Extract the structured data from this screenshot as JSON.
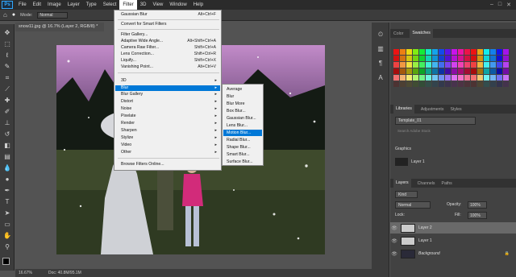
{
  "menubar": {
    "logo": "Ps",
    "items": [
      "File",
      "Edit",
      "Image",
      "Layer",
      "Type",
      "Select",
      "Filter",
      "3D",
      "View",
      "Window",
      "Help"
    ],
    "active": "Filter",
    "win_controls": [
      "–",
      "□",
      "✕"
    ]
  },
  "options": {
    "mode_label": "Mode:",
    "mode_value": "Normal",
    "opacity_label": "Opacity:",
    "opacity_value": "100%"
  },
  "document": {
    "tab": "snow11.jpg @ 16.7% (Layer 2, RGB/8) *",
    "zoom": "16.67%",
    "doc_size": "Doc: 40.8M/95.1M"
  },
  "filter_menu": {
    "items": [
      {
        "label": "Gaussian Blur",
        "shortcut": "Alt+Ctrl+F"
      },
      {
        "label": "Convert for Smart Filters",
        "shortcut": ""
      },
      {
        "label": "Filter Gallery...",
        "shortcut": ""
      },
      {
        "label": "Adaptive Wide Angle...",
        "shortcut": "Alt+Shift+Ctrl+A"
      },
      {
        "label": "Camera Raw Filter...",
        "shortcut": "Shift+Ctrl+A"
      },
      {
        "label": "Lens Correction...",
        "shortcut": "Shift+Ctrl+R"
      },
      {
        "label": "Liquify...",
        "shortcut": "Shift+Ctrl+X"
      },
      {
        "label": "Vanishing Point...",
        "shortcut": "Alt+Ctrl+V"
      },
      {
        "label": "3D",
        "shortcut": ""
      },
      {
        "label": "Blur",
        "shortcut": ""
      },
      {
        "label": "Blur Gallery",
        "shortcut": ""
      },
      {
        "label": "Distort",
        "shortcut": ""
      },
      {
        "label": "Noise",
        "shortcut": ""
      },
      {
        "label": "Pixelate",
        "shortcut": ""
      },
      {
        "label": "Render",
        "shortcut": ""
      },
      {
        "label": "Sharpen",
        "shortcut": ""
      },
      {
        "label": "Stylize",
        "shortcut": ""
      },
      {
        "label": "Video",
        "shortcut": ""
      },
      {
        "label": "Other",
        "shortcut": ""
      },
      {
        "label": "Browse Filters Online...",
        "shortcut": ""
      }
    ]
  },
  "blur_submenu": {
    "items": [
      "Average",
      "Blur",
      "Blur More",
      "Box Blur...",
      "Gaussian Blur...",
      "Lens Blur...",
      "Motion Blur...",
      "Radial Blur...",
      "Shape Blur...",
      "Smart Blur...",
      "Surface Blur..."
    ],
    "highlighted": "Motion Blur..."
  },
  "panels": {
    "color_tabs": [
      "Color",
      "Swatches"
    ],
    "library_tabs": [
      "Libraries",
      "Adjustments",
      "Styles"
    ],
    "library_name": "Template_01",
    "library_search": "Search Adobe Stock",
    "graphics_label": "Graphics",
    "graphics_item": "Layer 1",
    "layer_tabs": [
      "Layers",
      "Channels",
      "Paths"
    ],
    "kind_filter": "Kind",
    "blend_mode": "Normal",
    "opacity_label": "Opacity:",
    "opacity_value": "100%",
    "lock_label": "Lock:",
    "fill_label": "Fill:",
    "fill_value": "100%",
    "layers": [
      "Layer 2",
      "Layer 1",
      "Background"
    ]
  },
  "colors": {
    "highlight": "#0078d7",
    "panel_bg": "#424242",
    "menu_bg": "#f0f0f0"
  }
}
